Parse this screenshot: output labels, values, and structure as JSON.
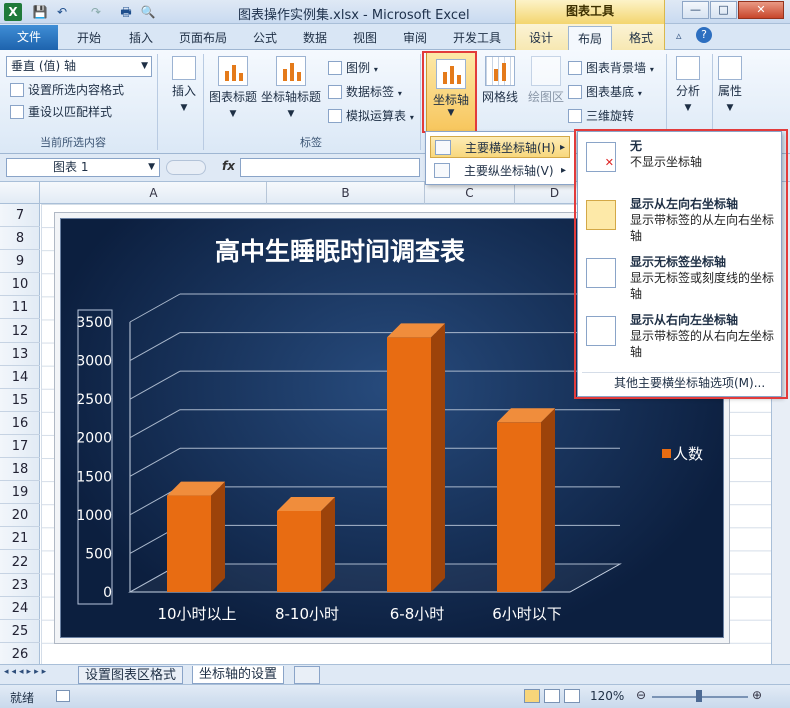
{
  "window": {
    "title": "图表操作实例集.xlsx - Microsoft Excel",
    "context_tab_group": "图表工具",
    "minimize": "—",
    "restore": "□",
    "close": "✕"
  },
  "qat": {
    "save": "💾",
    "undo": "↶",
    "redo": "↷",
    "print": "🖶",
    "preview": "🔍"
  },
  "tabs": {
    "file": "文件",
    "items": [
      "开始",
      "插入",
      "页面布局",
      "公式",
      "数据",
      "视图",
      "审阅",
      "开发工具",
      "设计",
      "布局",
      "格式"
    ],
    "active": "布局"
  },
  "ribbon": {
    "current_selection": {
      "combo_value": "垂直 (值) 轴",
      "format_selection": "设置所选内容格式",
      "reset_style": "重设以匹配样式",
      "group_label": "当前所选内容"
    },
    "insert": {
      "label": "插入"
    },
    "labels": {
      "chart_title": "图表标题",
      "axis_titles": "坐标轴标题",
      "legend": "图例",
      "data_labels": "数据标签",
      "data_table": "模拟运算表",
      "group_label": "标签"
    },
    "axes": {
      "axes": "坐标轴",
      "gridlines": "网格线",
      "plot_area": "绘图区",
      "chart_wall": "图表背景墙",
      "chart_floor": "图表基底",
      "rotation_3d": "三维旋转"
    },
    "analysis": {
      "label": "分析"
    },
    "properties": {
      "label": "属性"
    }
  },
  "formula_bar": {
    "name_box": "图表 1",
    "fx": "fx"
  },
  "columns": [
    "A",
    "B",
    "C",
    "D"
  ],
  "rows": [
    "7",
    "8",
    "9",
    "10",
    "11",
    "12",
    "13",
    "14",
    "15",
    "16",
    "17",
    "18",
    "19",
    "20",
    "21",
    "22",
    "23",
    "24",
    "25",
    "26"
  ],
  "chart_data": {
    "type": "bar",
    "title": "高中生睡眠时间调查表",
    "categories": [
      "10小时以上",
      "8-10小时",
      "6-8小时",
      "6小时以下"
    ],
    "series": [
      {
        "name": "人数",
        "values": [
          1250,
          1050,
          3300,
          2200
        ],
        "color": "#e86c12"
      }
    ],
    "yticks": [
      "0",
      "500",
      "1000",
      "1500",
      "2000",
      "2500",
      "3000",
      "3500"
    ],
    "ylim": [
      0,
      3500
    ],
    "grid": true,
    "legend_position": "right"
  },
  "menu1": {
    "items": [
      {
        "label": "主要横坐标轴(H)",
        "arrow": "▸"
      },
      {
        "label": "主要纵坐标轴(V)",
        "arrow": "▸"
      }
    ]
  },
  "menu2": {
    "items": [
      {
        "title": "无",
        "desc": "不显示坐标轴"
      },
      {
        "title": "显示从左向右坐标轴",
        "desc": "显示带标签的从左向右坐标轴"
      },
      {
        "title": "显示无标签坐标轴",
        "desc": "显示无标签或刻度线的坐标轴"
      },
      {
        "title": "显示从右向左坐标轴",
        "desc": "显示带标签的从右向左坐标轴"
      }
    ],
    "more": "其他主要横坐标轴选项(M)..."
  },
  "sheet_tabs": [
    "设置图表区格式",
    "坐标轴的设置"
  ],
  "status": {
    "ready": "就绪",
    "zoom": "120%"
  },
  "colors": {
    "accent": "#e23b3b",
    "bar": "#e86c12",
    "chart_bg": "#0c1f3f"
  }
}
